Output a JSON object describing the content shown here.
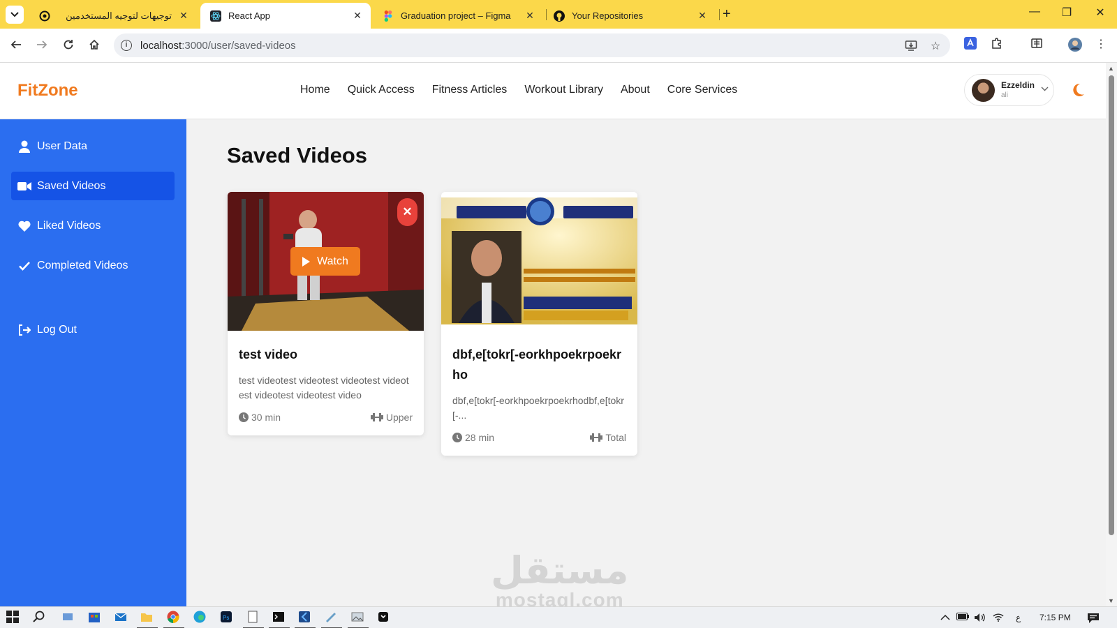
{
  "browser": {
    "tabs": [
      {
        "title": "توجيهات لتوجيه المستخدمين",
        "active": false,
        "icon": "openai-icon"
      },
      {
        "title": "React App",
        "active": true,
        "icon": "react-icon"
      },
      {
        "title": "Graduation project – Figma",
        "active": false,
        "icon": "figma-icon"
      },
      {
        "title": "Your Repositories",
        "active": false,
        "icon": "github-icon"
      }
    ],
    "url_host": "localhost",
    "url_path": ":3000/user/saved-videos"
  },
  "app": {
    "logo": "FitZone",
    "nav": [
      "Home",
      "Quick Access",
      "Fitness Articles",
      "Workout Library",
      "About",
      "Core Services"
    ],
    "user": {
      "name": "Ezzeldin",
      "subtitle": "ali"
    },
    "accent_color": "#f07a1f",
    "sidebar_color": "#2b6ef0"
  },
  "sidebar": {
    "items": [
      {
        "label": "User Data",
        "icon": "user-icon",
        "active": false
      },
      {
        "label": "Saved Videos",
        "icon": "video-icon",
        "active": true
      },
      {
        "label": "Liked Videos",
        "icon": "heart-icon",
        "active": false
      },
      {
        "label": "Completed Videos",
        "icon": "check-icon",
        "active": false
      }
    ],
    "logout": "Log Out"
  },
  "page": {
    "title": "Saved Videos"
  },
  "videos": [
    {
      "title": "test video",
      "description": "test videotest videotest videotest videotest videotest videotest video",
      "duration": "30 min",
      "category": "Upper",
      "watch_label": "Watch",
      "remove_label": "✕"
    },
    {
      "title": "dbf,e[tokr[-eorkhpoekrpoekrho",
      "description": "dbf,e[tokr[-eorkhpoekrpoekrhodbf,e[tokr[-...",
      "duration": "28 min",
      "category": "Total"
    }
  ],
  "watermark": {
    "arabic": "مستقل",
    "latin": "mostaql.com"
  },
  "taskbar": {
    "lang": "ع",
    "time": "7:15 PM"
  }
}
